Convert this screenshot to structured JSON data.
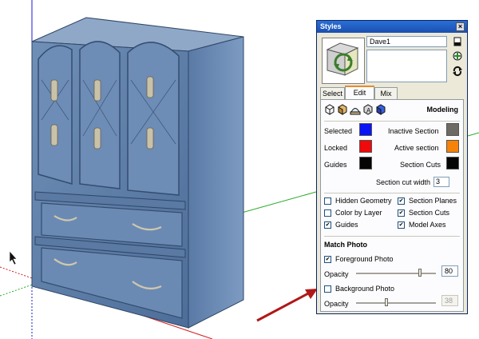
{
  "panel": {
    "title": "Styles",
    "close_glyph": "×",
    "style_name": "Dave1",
    "side_icons": [
      "create-style-icon",
      "update-style-icon",
      "refresh-icon"
    ]
  },
  "tabs": [
    {
      "label": "Select",
      "active": false
    },
    {
      "label": "Edit",
      "active": true
    },
    {
      "label": "Mix",
      "active": false
    }
  ],
  "edit": {
    "section_title": "Modeling",
    "mode_icons": [
      "edge-settings-icon",
      "face-settings-icon",
      "background-settings-icon",
      "watermark-settings-icon",
      "modeling-settings-icon"
    ],
    "colors": [
      {
        "label": "Selected",
        "color": "#0a14f5"
      },
      {
        "label": "Locked",
        "color": "#f00a0a"
      },
      {
        "label": "Guides",
        "color": "#050505"
      },
      {
        "label": "Inactive Section",
        "color": "#6e6a64"
      },
      {
        "label": "Active section",
        "color": "#f7820a"
      },
      {
        "label": "Section Cuts",
        "color": "#050505"
      }
    ],
    "section_cut_width_label": "Section cut width",
    "section_cut_width": "3",
    "checkboxes": [
      {
        "label": "Hidden Geometry",
        "checked": false
      },
      {
        "label": "Color by Layer",
        "checked": false
      },
      {
        "label": "Guides",
        "checked": true
      },
      {
        "label": "Section Planes",
        "checked": true
      },
      {
        "label": "Section Cuts",
        "checked": true
      },
      {
        "label": "Model Axes",
        "checked": true
      }
    ],
    "match_photo": {
      "title": "Match Photo",
      "foreground_label": "Foreground Photo",
      "foreground_checked": true,
      "opacity_label": "Opacity",
      "foreground_opacity": "80",
      "background_label": "Background Photo",
      "background_checked": false,
      "background_opacity": "38"
    }
  }
}
